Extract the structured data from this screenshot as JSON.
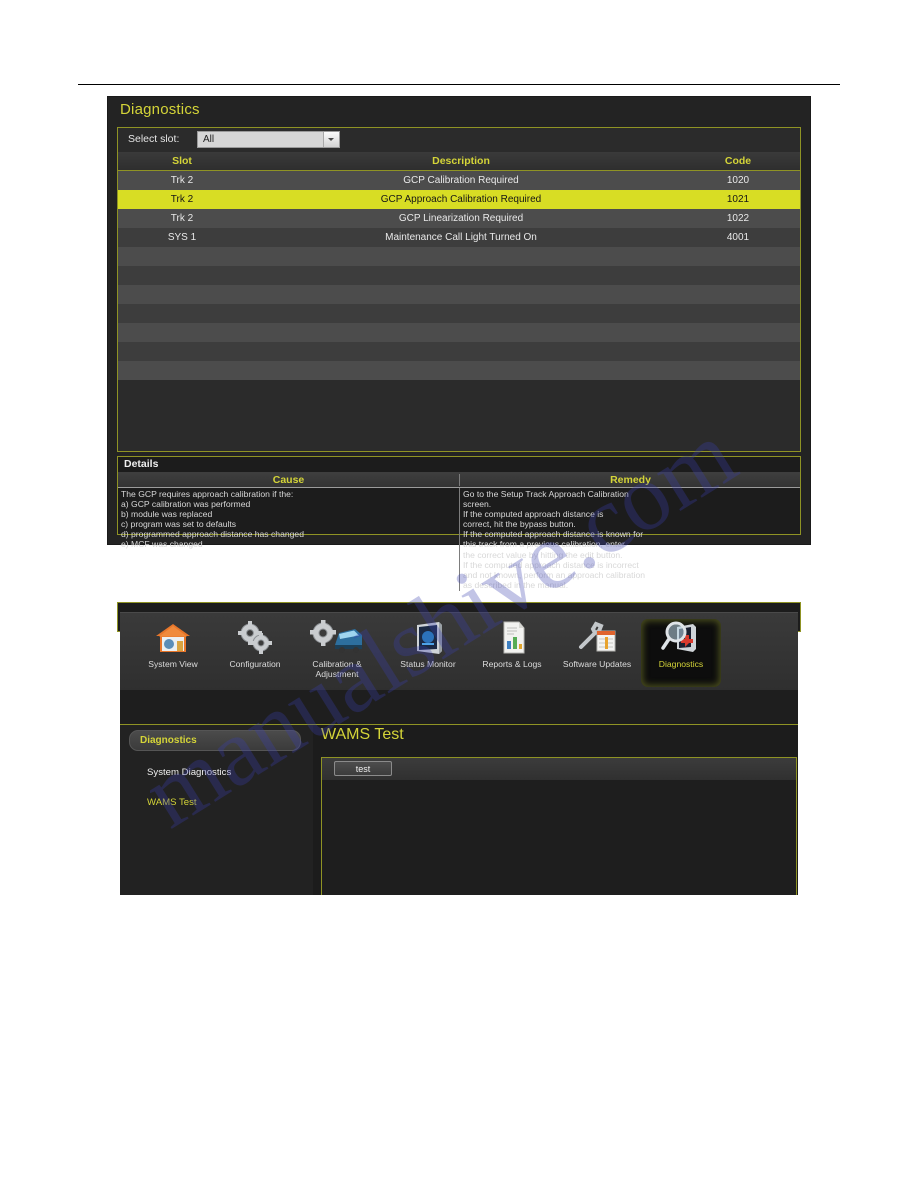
{
  "figure1": {
    "window_title": "Diagnostics",
    "select_slot_label": "Select slot:",
    "select_slot_value": "All",
    "table": {
      "headers": [
        "Slot",
        "Description",
        "Code"
      ],
      "rows": [
        {
          "slot": "Trk 2",
          "description": "GCP Calibration Required",
          "code": "1020",
          "selected": false
        },
        {
          "slot": "Trk 2",
          "description": "GCP Approach Calibration Required",
          "code": "1021",
          "selected": true
        },
        {
          "slot": "Trk 2",
          "description": "GCP Linearization Required",
          "code": "1022",
          "selected": false
        },
        {
          "slot": "SYS 1",
          "description": "Maintenance Call Light Turned On",
          "code": "4001",
          "selected": false
        }
      ],
      "empty_row_count": 7
    },
    "details": {
      "title": "Details",
      "headers": [
        "Cause",
        "Remedy"
      ],
      "cause_lines": [
        "The GCP requires approach calibration if the:",
        "a) GCP calibration was performed",
        "b) module was replaced",
        "c) program was set to defaults",
        "d) programmed approach distance has changed",
        "e) MCF was changed"
      ],
      "remedy_lines": [
        "Go to the Setup Track Approach Calibration",
        "screen.",
        "If the computed approach distance is",
        "correct, hit the bypass button.",
        "If the computed approach distance is known for",
        "this track from a previous calibration, enter",
        "the correct value by hitting the edit button.",
        "If the computed approach distance is incorrect",
        "and not known, perform an approach calibration",
        "as described in the manual."
      ]
    }
  },
  "figure2": {
    "toolbar": [
      {
        "label": "System View",
        "icon": "house-icon",
        "active": false
      },
      {
        "label": "Configuration",
        "icon": "gears-icon",
        "active": false
      },
      {
        "label": "Calibration & Adjustment",
        "icon": "gear-train-icon",
        "active": false
      },
      {
        "label": "Status Monitor",
        "icon": "monitor-icon",
        "active": false
      },
      {
        "label": "Reports & Logs",
        "icon": "document-chart-icon",
        "active": false
      },
      {
        "label": "Software Updates",
        "icon": "wrench-calendar-icon",
        "active": false
      },
      {
        "label": "Diagnostics",
        "icon": "magnifier-monitor-icon",
        "active": true
      }
    ],
    "sidebar": {
      "tab_label": "Diagnostics",
      "items": [
        {
          "label": "System Diagnostics",
          "selected": false
        },
        {
          "label": "WAMS Test",
          "selected": true
        }
      ]
    },
    "content": {
      "title": "WAMS Test",
      "test_button_label": "test"
    }
  },
  "colors": {
    "accent_yellow": "#d4d438",
    "border_olive": "#8f9324",
    "selected_row": "#d8dd24",
    "panel_dark": "#232323"
  },
  "watermark": {
    "line1": "manualshive.com"
  }
}
